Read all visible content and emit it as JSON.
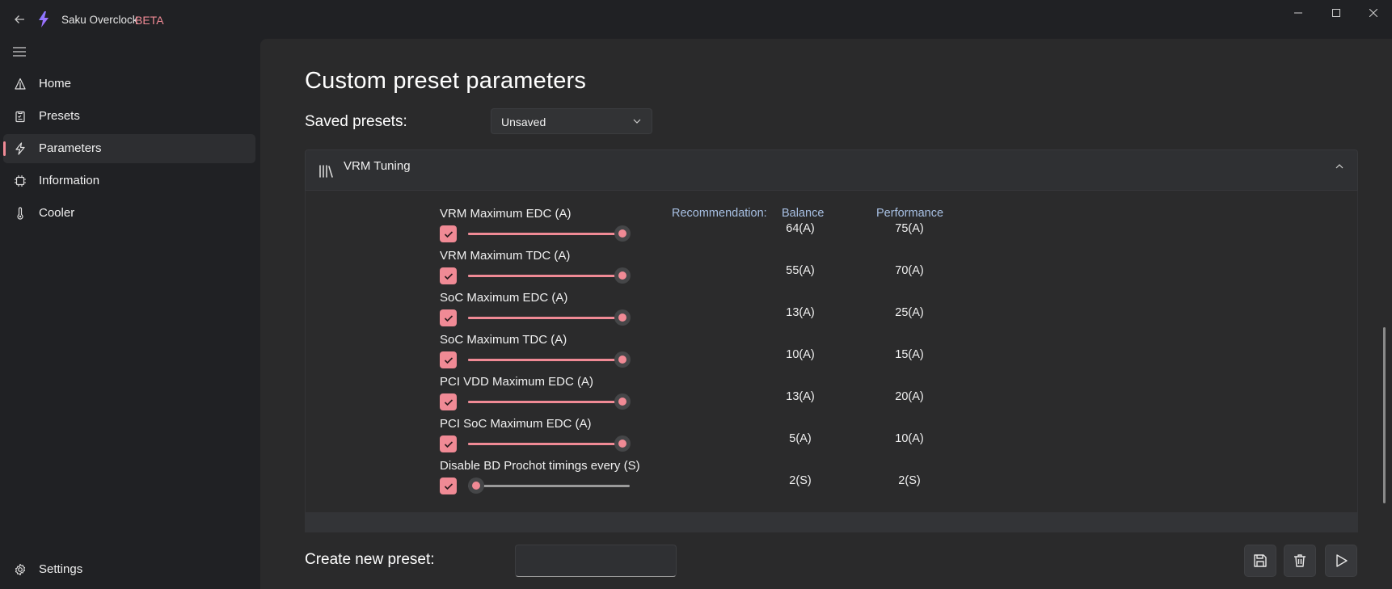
{
  "window": {
    "app_name": "Saku Overclock",
    "badge": "BETA",
    "accent_color": "#f08a95"
  },
  "sidebar": {
    "items": [
      {
        "label": "Home",
        "icon": "home-icon"
      },
      {
        "label": "Presets",
        "icon": "clipboard-icon"
      },
      {
        "label": "Parameters",
        "icon": "lightning-icon",
        "active": true
      },
      {
        "label": "Information",
        "icon": "chip-icon"
      },
      {
        "label": "Cooler",
        "icon": "thermometer-icon"
      }
    ],
    "settings_label": "Settings"
  },
  "main": {
    "title": "Custom preset parameters",
    "saved_presets_label": "Saved presets:",
    "saved_presets_value": "Unsaved",
    "section": {
      "title": "VRM Tuning",
      "expanded": true,
      "recommendation_label": "Recommendation:",
      "balance_header": "Balance",
      "performance_header": "Performance",
      "params": [
        {
          "label": "VRM Maximum EDC (A)",
          "checked": true,
          "level": 1.0,
          "balance": "64(A)",
          "performance": "75(A)"
        },
        {
          "label": "VRM Maximum TDC (A)",
          "checked": true,
          "level": 1.0,
          "balance": "55(A)",
          "performance": "70(A)"
        },
        {
          "label": "SoC Maximum EDC (A)",
          "checked": true,
          "level": 1.0,
          "balance": "13(A)",
          "performance": "25(A)"
        },
        {
          "label": "SoC Maximum TDC (A)",
          "checked": true,
          "level": 1.0,
          "balance": "10(A)",
          "performance": "15(A)"
        },
        {
          "label": "PCI VDD Maximum EDC (A)",
          "checked": true,
          "level": 1.0,
          "balance": "13(A)",
          "performance": "20(A)"
        },
        {
          "label": "PCI SoC Maximum EDC (A)",
          "checked": true,
          "level": 1.0,
          "balance": "5(A)",
          "performance": "10(A)"
        },
        {
          "label": "Disable BD Prochot timings every (S)",
          "checked": true,
          "level": 0.0,
          "balance": "2(S)",
          "performance": "2(S)"
        }
      ]
    },
    "create_preset_label": "Create new preset:",
    "create_preset_value": "",
    "actions": [
      "save-icon",
      "trash-icon",
      "play-icon"
    ]
  }
}
